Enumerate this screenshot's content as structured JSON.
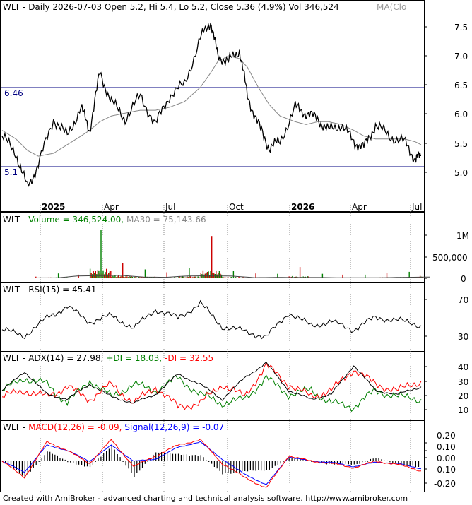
{
  "price_panel": {
    "ticker": "WLT",
    "title_text": "WLT - Daily 2026-07-03 Open 5.2, Hi 5.4, Lo 5.2, Close 5.36 (4.9%) Vol 346,524",
    "ma_tag": "MA(Clo",
    "levels": [
      {
        "label": "6.46",
        "value": 6.46
      },
      {
        "label": "5.1",
        "value": 5.1
      }
    ],
    "y_ticks": [
      "7.5",
      "7.0",
      "6.5",
      "6.0",
      "5.5",
      "5.0"
    ],
    "x_ticks": [
      "2025",
      "Apr",
      "Jul",
      "Oct",
      "2026",
      "Apr",
      "Jul"
    ]
  },
  "volume_panel": {
    "label_prefix": "WLT - ",
    "label_volume": "Volume = 346,524.00,",
    "label_ma": "MA30 = 75,143.66",
    "y_ticks": [
      "1M",
      "500,000",
      "0"
    ]
  },
  "rsi_panel": {
    "label": "WLT - RSI(15) = 45.41",
    "y_ticks": [
      "70",
      "30"
    ]
  },
  "adx_panel": {
    "label_prefix": "WLT - ",
    "label_adx": "ADX(14) = 27.98,",
    "label_pdi": "+DI = 18.03,",
    "label_mdi": "-DI = 32.55",
    "y_ticks": [
      "40",
      "30",
      "20",
      "10"
    ]
  },
  "macd_panel": {
    "label_prefix": "WLT - ",
    "label_macd": "MACD(12,26) = -0.09,",
    "label_signal": "Signal(12,26,9) = -0.07",
    "y_ticks": [
      "0.20",
      "0.10",
      "0.00",
      "-0.10",
      "-0.20"
    ]
  },
  "footer": "Created with AmiBroker - advanced charting and technical analysis software. http://www.amibroker.com",
  "colors": {
    "volume_up": "#008000",
    "volume_down": "#cc0000",
    "pdi": "#008000",
    "mdi": "#ff0000",
    "signal": "#0000ff",
    "macd": "#ff0000",
    "level": "#000080"
  },
  "chart_data": [
    {
      "type": "line",
      "title": "WLT - Daily 2026-07-03 Open 5.2, Hi 5.4, Lo 5.2, Close 5.36 (4.9%) Vol 346,524",
      "x": [
        "2024-12-01",
        "2024-12-20",
        "2025-01-05",
        "2025-01-20",
        "2025-02-10",
        "2025-03-01",
        "2025-03-20",
        "2025-04-01",
        "2025-04-15",
        "2025-05-01",
        "2025-05-20",
        "2025-06-10",
        "2025-07-01",
        "2025-07-20",
        "2025-08-10",
        "2025-09-01",
        "2025-09-15",
        "2025-09-25",
        "2025-10-10",
        "2025-10-25",
        "2025-11-05",
        "2025-11-20",
        "2025-12-05",
        "2025-12-20",
        "2026-01-10",
        "2026-01-25",
        "2026-02-10",
        "2026-02-25",
        "2026-03-15",
        "2026-04-01",
        "2026-04-15",
        "2026-05-01",
        "2026-05-20",
        "2026-06-10",
        "2026-06-25",
        "2026-07-03"
      ],
      "series": [
        {
          "name": "WLT",
          "values": [
            5.7,
            5.4,
            4.8,
            5.2,
            6.0,
            5.7,
            6.2,
            5.8,
            6.8,
            6.3,
            6.0,
            6.4,
            5.9,
            6.4,
            6.6,
            7.4,
            7.7,
            7.1,
            7.0,
            7.2,
            6.4,
            5.9,
            5.5,
            5.6,
            6.2,
            6.1,
            6.0,
            5.8,
            5.9,
            5.6,
            5.5,
            5.9,
            5.7,
            5.6,
            5.3,
            5.36
          ]
        },
        {
          "values": [
            5.8,
            5.65,
            5.45,
            5.35,
            5.4,
            5.55,
            5.7,
            5.8,
            5.95,
            6.05,
            6.1,
            6.15,
            6.15,
            6.2,
            6.3,
            6.55,
            6.8,
            7.0,
            7.1,
            7.05,
            6.9,
            6.55,
            6.25,
            6.05,
            5.95,
            5.9,
            5.95,
            5.95,
            5.9,
            5.8,
            5.7,
            5.65,
            5.65,
            5.65,
            5.6,
            5.55
          ]
        }
      ],
      "levels": [
        6.46,
        5.1
      ],
      "ylim": [
        4.6,
        7.85
      ]
    },
    {
      "type": "bar",
      "title": "Volume",
      "x": [
        "2025-01",
        "2025-02",
        "2025-03",
        "2025-04",
        "2025-05",
        "2025-06",
        "2025-07",
        "2025-08",
        "2025-09",
        "2025-10",
        "2025-11",
        "2025-12",
        "2026-01",
        "2026-02",
        "2026-03",
        "2026-04",
        "2026-05",
        "2026-06",
        "2026-07"
      ],
      "values": [
        40000,
        120000,
        90000,
        1200000,
        380000,
        220000,
        150000,
        260000,
        1050000,
        180000,
        120000,
        110000,
        280000,
        110000,
        90000,
        90000,
        130000,
        160000,
        346524
      ],
      "ylim": [
        0,
        1300000
      ]
    },
    {
      "type": "line",
      "title": "WLT - RSI(15) = 45.41",
      "x": [
        "2024-12-01",
        "2025-01-01",
        "2025-02-01",
        "2025-03-01",
        "2025-04-01",
        "2025-05-01",
        "2025-06-01",
        "2025-07-01",
        "2025-08-01",
        "2025-09-01",
        "2025-10-01",
        "2025-11-01",
        "2025-12-01",
        "2026-01-01",
        "2026-02-01",
        "2026-03-01",
        "2026-04-01",
        "2026-05-01",
        "2026-06-01",
        "2026-07-03"
      ],
      "series": [
        {
          "values": [
            40,
            32,
            55,
            70,
            50,
            58,
            42,
            66,
            55,
            74,
            44,
            38,
            30,
            62,
            45,
            50,
            40,
            56,
            52,
            45.41
          ]
        }
      ],
      "ylim": [
        15,
        90
      ]
    },
    {
      "type": "line",
      "title": "WLT - ADX(14) = 27.98, +DI = 18.03, -DI = 32.55",
      "x": [
        "2024-12-01",
        "2025-01-01",
        "2025-02-01",
        "2025-03-01",
        "2025-04-01",
        "2025-05-01",
        "2025-06-01",
        "2025-07-01",
        "2025-08-01",
        "2025-09-01",
        "2025-10-01",
        "2025-11-01",
        "2025-12-01",
        "2026-01-01",
        "2026-02-01",
        "2026-03-01",
        "2026-04-01",
        "2026-05-01",
        "2026-06-01",
        "2026-07-03"
      ],
      "series": [
        {
          "name": "ADX(14)",
          "values": [
            25,
            40,
            22,
            18,
            30,
            20,
            15,
            22,
            38,
            30,
            18,
            35,
            47,
            25,
            18,
            22,
            45,
            25,
            22,
            27.98
          ]
        },
        {
          "name": "+DI",
          "values": [
            25,
            35,
            30,
            15,
            33,
            20,
            30,
            25,
            35,
            22,
            15,
            18,
            35,
            22,
            25,
            15,
            12,
            25,
            20,
            18.03
          ]
        },
        {
          "name": "-DI",
          "values": [
            20,
            25,
            20,
            28,
            18,
            30,
            15,
            28,
            12,
            15,
            30,
            20,
            45,
            30,
            20,
            25,
            42,
            30,
            25,
            32.55
          ]
        }
      ],
      "ylim": [
        3,
        48
      ]
    },
    {
      "type": "line",
      "title": "WLT - MACD(12,26) = -0.09, Signal(12,26,9) = -0.07",
      "x": [
        "2024-12-01",
        "2025-01-01",
        "2025-02-01",
        "2025-03-01",
        "2025-04-01",
        "2025-05-01",
        "2025-06-01",
        "2025-07-01",
        "2025-08-01",
        "2025-09-01",
        "2025-10-01",
        "2025-11-01",
        "2025-12-01",
        "2026-01-01",
        "2026-02-01",
        "2026-03-01",
        "2026-04-01",
        "2026-05-01",
        "2026-06-01",
        "2026-07-03"
      ],
      "series": [
        {
          "name": "MACD(12,26)",
          "values": [
            0.0,
            -0.15,
            0.18,
            0.1,
            -0.02,
            0.2,
            -0.05,
            0.05,
            0.15,
            0.2,
            -0.02,
            -0.15,
            -0.25,
            0.05,
            0.0,
            -0.02,
            -0.06,
            0.0,
            -0.03,
            -0.09
          ]
        },
        {
          "name": "Signal(12,26,9)",
          "values": [
            0.0,
            -0.1,
            0.15,
            0.1,
            0.0,
            0.15,
            0.0,
            0.02,
            0.13,
            0.18,
            0.02,
            -0.12,
            -0.22,
            0.04,
            0.0,
            -0.01,
            -0.05,
            -0.01,
            -0.02,
            -0.07
          ]
        }
      ],
      "ylim": [
        -0.27,
        0.27
      ]
    }
  ]
}
